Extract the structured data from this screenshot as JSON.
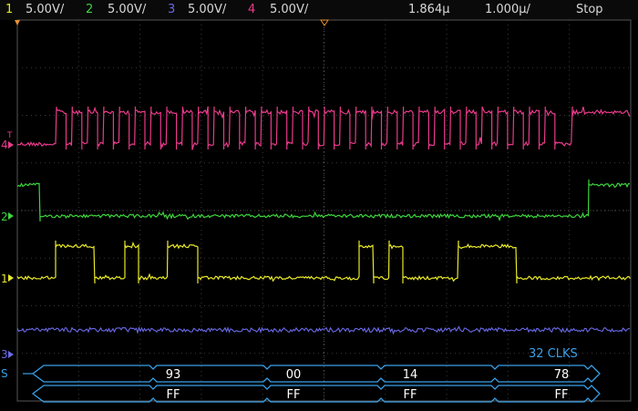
{
  "header": {
    "channels": [
      {
        "num": "1",
        "scale": "5.00V/",
        "color": "#e8e82a"
      },
      {
        "num": "2",
        "scale": "5.00V/",
        "color": "#3cd43c"
      },
      {
        "num": "3",
        "scale": "5.00V/",
        "color": "#6a6ae8"
      },
      {
        "num": "4",
        "scale": "5.00V/",
        "color": "#e83a8a"
      }
    ],
    "time_position": "1.864µ",
    "time_scale": "1.000µ/",
    "run_state": "Stop"
  },
  "markers": {
    "ch4": "4",
    "ch4_trigger": "T",
    "ch2": "2",
    "ch1": "1",
    "ch3": "3",
    "bus": "S"
  },
  "bus": {
    "label": "32 CLKS",
    "row1": [
      "93",
      "00",
      "14",
      "78"
    ],
    "row2": [
      "FF",
      "FF",
      "FF",
      "FF"
    ]
  },
  "colors": {
    "ch1": "#e8e82a",
    "ch2": "#3cd43c",
    "ch3": "#6a6ae8",
    "ch4": "#e83a8a",
    "bus": "#3aa0e8",
    "grid": "#3a3a3a"
  }
}
